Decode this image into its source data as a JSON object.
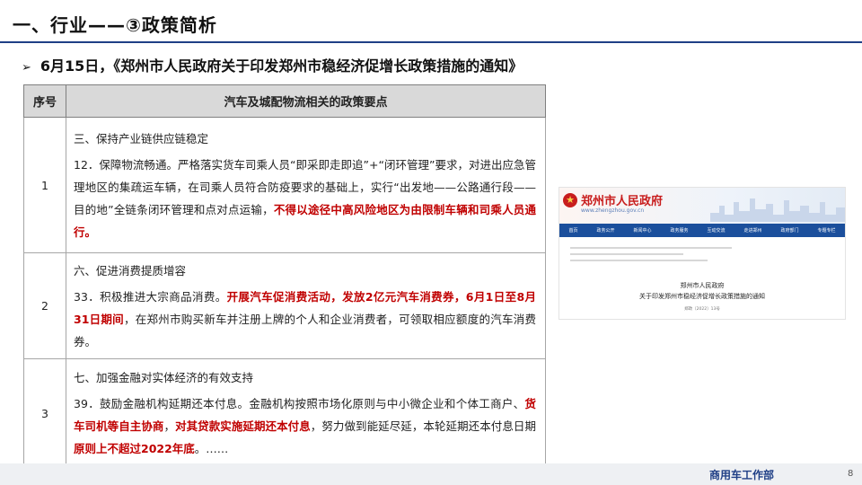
{
  "header": {
    "title": "一、行业——③政策简析",
    "subtitle_arrow": "➢",
    "subtitle": "6月15日，《郑州市人民政府关于印发郑州市稳经济促增长政策措施的通知》"
  },
  "table": {
    "col_num": "序号",
    "col_content": "汽车及城配物流相关的政策要点",
    "rows": [
      {
        "num": "1",
        "heading": "三、保持产业链供应链稳定",
        "text": "12．保障物流畅通。严格落实货车司乘人员“即采即走即追”+“闭环管理”要求，对进出应急管理地区的集疏运车辆，在司乘人员符合防疫要求的基础上，实行“出发地——公路通行段——目的地”全链条闭环管理和点对点运输，",
        "highlight": "不得以途径中高风险地区为由限制车辆和司乘人员通行。"
      },
      {
        "num": "2",
        "heading": "六、促进消费提质增容",
        "text_a": "33．积极推进大宗商品消费。",
        "highlight": "开展汽车促消费活动，发放2亿元汽车消费券，6月1日至8月31日期间",
        "text_b": "，在郑州市购买新车并注册上牌的个人和企业消费者，可领取相应额度的汽车消费券。"
      },
      {
        "num": "3",
        "heading": "七、加强金融对实体经济的有效支持",
        "text_a": "39．鼓励金融机构延期还本付息。金融机构按照市场化原则与中小微企业和个体工商户、",
        "highlight_a": "货车司机等自主协商",
        "text_b": "，",
        "highlight_b": "对其贷款实施延期还本付息",
        "text_c": "，努力做到能延尽延，本轮延期还本付息日期",
        "highlight_c": "原则上不超过2022年底",
        "text_d": "。……"
      }
    ]
  },
  "screenshot": {
    "gov_name": "郑州市人民政府",
    "gov_url": "www.zhengzhou.gov.cn",
    "nav": [
      "首页",
      "政务公开",
      "新闻中心",
      "政务服务",
      "互动交流",
      "走进郑州",
      "政府部门",
      "专题专栏"
    ],
    "notice_org": "郑州市人民政府",
    "notice_title": "关于印发郑州市稳经济促增长政策措施的通知",
    "notice_no": "郑政〔2022〕13号"
  },
  "footer": {
    "label": "商用车工作部",
    "page": "8"
  },
  "colors": {
    "accent_blue": "#1f3f86",
    "highlight_red": "#c00000",
    "header_gray": "#d9d9d9"
  }
}
